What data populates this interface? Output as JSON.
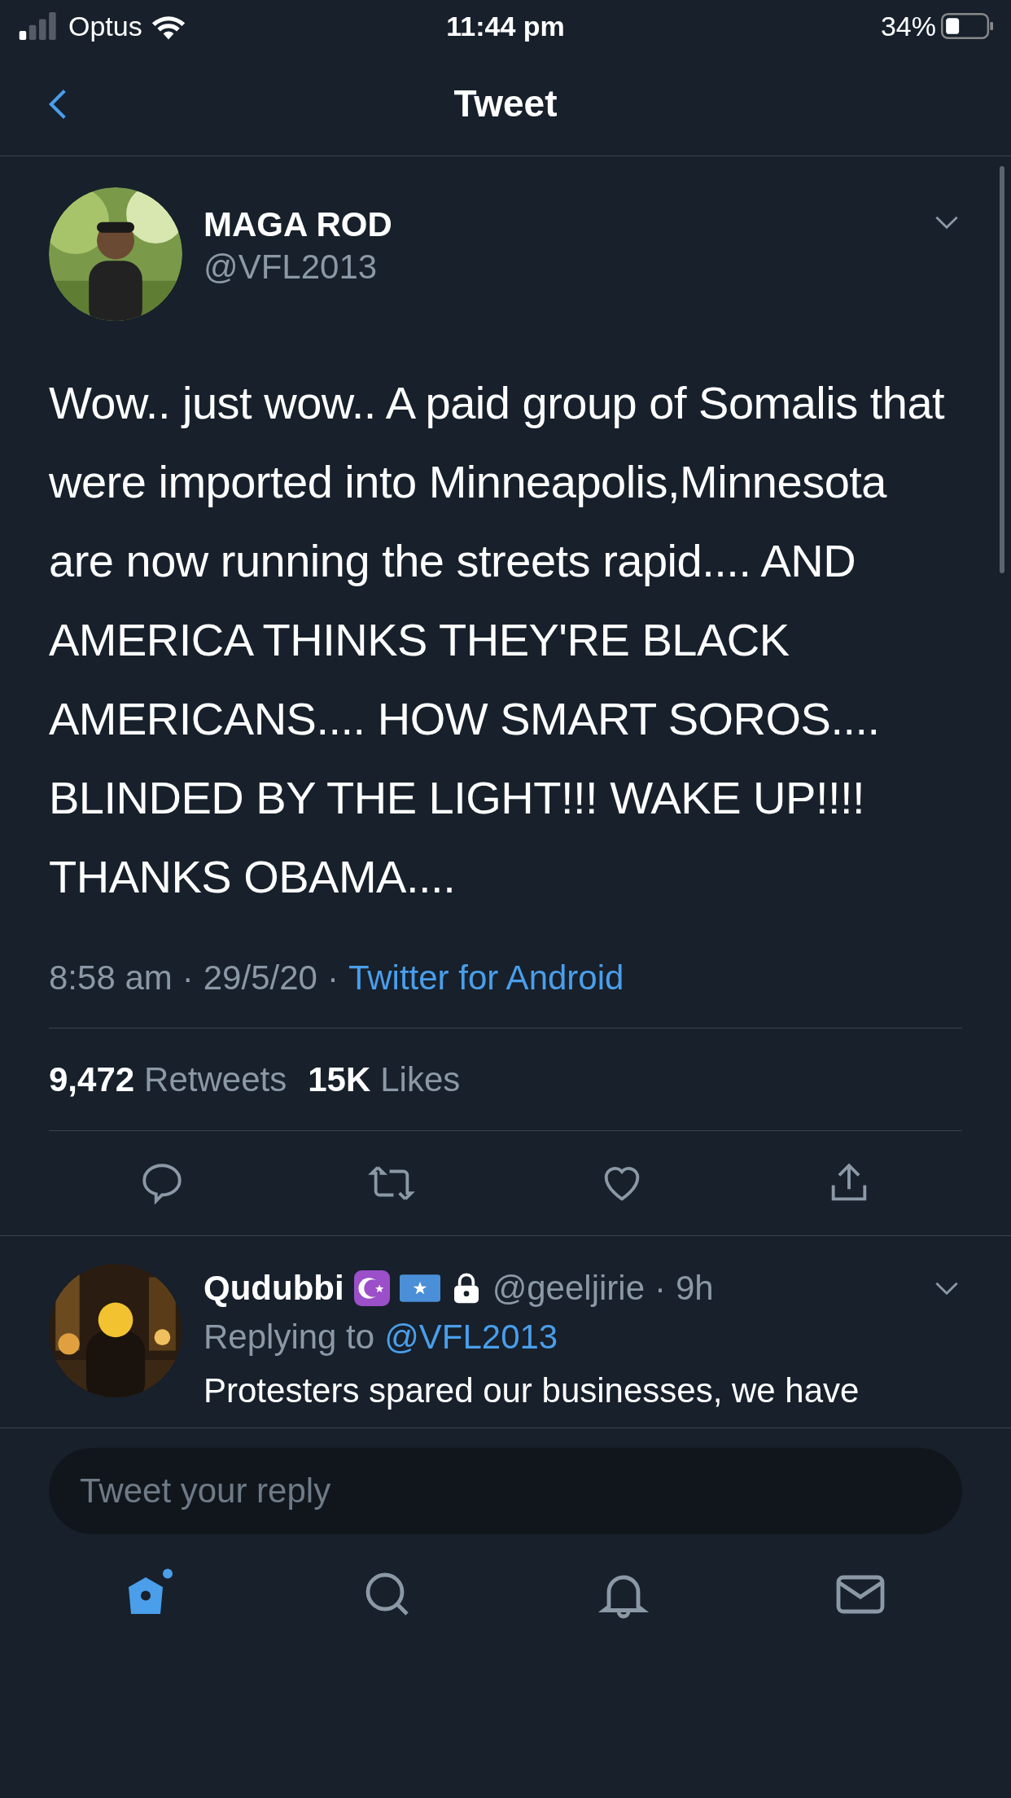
{
  "status_bar": {
    "carrier": "Optus",
    "time": "11:44 pm",
    "battery": "34%"
  },
  "header": {
    "title": "Tweet"
  },
  "tweet": {
    "author": {
      "name": "MAGA ROD",
      "handle": "@VFL2013"
    },
    "text": "Wow.. just wow.. A paid group of Somalis that were imported into Minneapolis,Minnesota are now running the streets rapid.... AND AMERICA THINKS THEY'RE BLACK AMERICANS.... HOW SMART SOROS.... BLINDED BY THE LIGHT!!! WAKE UP!!!! THANKS OBAMA....",
    "time": "8:58 am",
    "date": "29/5/20",
    "source": "Twitter for Android",
    "separator": "·",
    "stats": [
      {
        "count": "9,472",
        "label": "Retweets"
      },
      {
        "count": "15K",
        "label": "Likes"
      }
    ]
  },
  "replies": [
    {
      "name": "Qudubbi",
      "handle": "@geeljirie",
      "separator": "·",
      "age": "9h",
      "replying_label": "Replying to",
      "replying_to": "@VFL2013",
      "text": "Protesters spared our businesses, we have"
    }
  ],
  "reply_box": {
    "placeholder": "Tweet your reply"
  },
  "tab_bar": [
    {
      "kind": "home",
      "selected": true
    },
    {
      "kind": "search",
      "selected": false
    },
    {
      "kind": "notifications",
      "selected": false
    },
    {
      "kind": "messages",
      "selected": false
    }
  ]
}
